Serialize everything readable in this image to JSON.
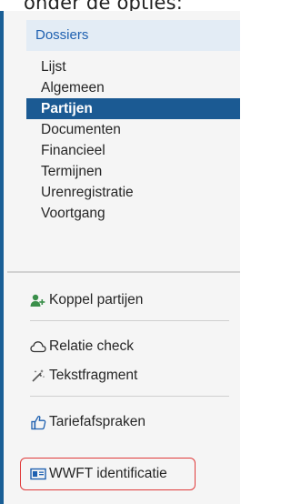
{
  "top_fragment": "onder de opties:",
  "sidebar": {
    "header": "Dossiers",
    "items": [
      {
        "label": "Lijst"
      },
      {
        "label": "Algemeen"
      },
      {
        "label": "Partijen"
      },
      {
        "label": "Documenten"
      },
      {
        "label": "Financieel"
      },
      {
        "label": "Termijnen"
      },
      {
        "label": "Urenregistratie"
      },
      {
        "label": "Voortgang"
      }
    ],
    "active_index": 2
  },
  "actions": {
    "koppel": {
      "label": "Koppel partijen",
      "icon": "person-add-icon"
    },
    "relatie": {
      "label": "Relatie check",
      "icon": "cloud-icon"
    },
    "tekst": {
      "label": "Tekstfragment",
      "icon": "magic-wand-icon"
    },
    "tarief": {
      "label": "Tariefafspraken",
      "icon": "thumbs-up-icon"
    },
    "wwft": {
      "label": "WWFT identificatie",
      "icon": "id-card-icon"
    }
  },
  "colors": {
    "accent": "#1b5a93",
    "header_bg": "#e3ecf5",
    "header_text": "#1e60b0",
    "highlight_border": "#e03b3b",
    "icon_green": "#3a8f4a"
  }
}
